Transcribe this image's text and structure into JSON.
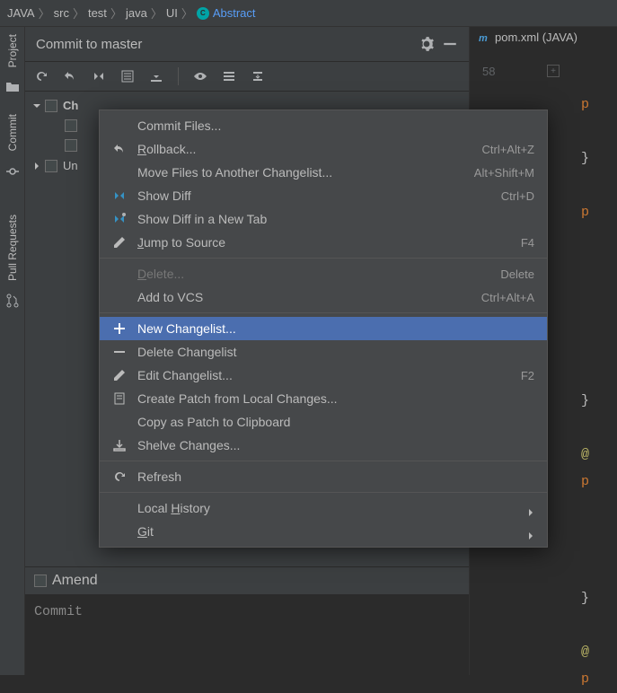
{
  "breadcrumb": {
    "items": [
      "JAVA",
      "src",
      "test",
      "java",
      "UI"
    ],
    "class": "Abstract"
  },
  "panel": {
    "title": "Commit to master"
  },
  "tree": {
    "changes": "Ch",
    "unversioned": "Un"
  },
  "amend": {
    "label": "Amend"
  },
  "commit_msg": {
    "placeholder": "Commit"
  },
  "editor": {
    "tab": "pom.xml (JAVA)",
    "line": "58"
  },
  "side": {
    "project": "Project",
    "commit": "Commit",
    "pull": "Pull Requests"
  },
  "menu": {
    "items": [
      {
        "label": "Commit Files...",
        "shortcut": "",
        "icon": ""
      },
      {
        "label": "Rollback...",
        "shortcut": "Ctrl+Alt+Z",
        "icon": "rollback",
        "mn": 0
      },
      {
        "label": "Move Files to Another Changelist...",
        "shortcut": "Alt+Shift+M",
        "icon": ""
      },
      {
        "label": "Show Diff",
        "shortcut": "Ctrl+D",
        "icon": "diff"
      },
      {
        "label": "Show Diff in a New Tab",
        "shortcut": "",
        "icon": "diff-pin"
      },
      {
        "label": "Jump to Source",
        "shortcut": "F4",
        "icon": "pencil",
        "mn": 0
      },
      {
        "sep": true
      },
      {
        "label": "Delete...",
        "shortcut": "Delete",
        "disabled": true,
        "mn": 0
      },
      {
        "label": "Add to VCS",
        "shortcut": "Ctrl+Alt+A"
      },
      {
        "sep": true
      },
      {
        "label": "New Changelist...",
        "shortcut": "",
        "icon": "plus",
        "highlight": true
      },
      {
        "label": "Delete Changelist",
        "shortcut": "",
        "icon": "minus"
      },
      {
        "label": "Edit Changelist...",
        "shortcut": "F2",
        "icon": "pencil"
      },
      {
        "label": "Create Patch from Local Changes...",
        "shortcut": "",
        "icon": "patch"
      },
      {
        "label": "Copy as Patch to Clipboard",
        "shortcut": ""
      },
      {
        "label": "Shelve Changes...",
        "shortcut": "",
        "icon": "shelve"
      },
      {
        "sep": true
      },
      {
        "label": "Refresh",
        "shortcut": "",
        "icon": "refresh"
      },
      {
        "sep": true
      },
      {
        "label": "Local History",
        "sub": true,
        "mn": 6
      },
      {
        "label": "Git",
        "sub": true,
        "mn": 0
      }
    ]
  }
}
